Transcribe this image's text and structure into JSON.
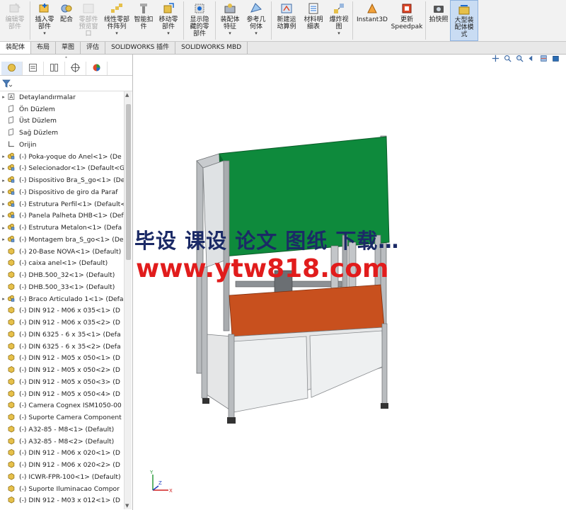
{
  "ribbon": {
    "buttons": [
      {
        "label": "编辑零\n部件",
        "disabled": true,
        "icon": "edit-component-icon",
        "dropdown": false
      },
      {
        "label": "插入零\n部件",
        "disabled": false,
        "icon": "insert-component-icon",
        "dropdown": true
      },
      {
        "label": "配合",
        "disabled": false,
        "icon": "mate-icon",
        "dropdown": false
      },
      {
        "label": "零部件\n预览窗\n口",
        "disabled": true,
        "icon": "component-preview-icon",
        "dropdown": false
      },
      {
        "label": "线性零部\n件阵列",
        "disabled": false,
        "icon": "linear-pattern-icon",
        "dropdown": true
      },
      {
        "label": "智能扣\n件",
        "disabled": false,
        "icon": "smart-fastener-icon",
        "dropdown": false
      },
      {
        "label": "移动零\n部件",
        "disabled": false,
        "icon": "move-component-icon",
        "dropdown": true
      },
      {
        "label": "显示隐\n藏的零\n部件",
        "disabled": false,
        "icon": "show-hidden-icon",
        "dropdown": false
      },
      {
        "label": "装配体\n特征",
        "disabled": false,
        "icon": "assembly-feature-icon",
        "dropdown": true
      },
      {
        "label": "参考几\n何体",
        "disabled": false,
        "icon": "reference-geometry-icon",
        "dropdown": true
      },
      {
        "label": "新建运\n动算例",
        "disabled": false,
        "icon": "motion-study-icon",
        "dropdown": false
      },
      {
        "label": "材料明\n细表",
        "disabled": false,
        "icon": "bom-icon",
        "dropdown": false
      },
      {
        "label": "爆炸视\n图",
        "disabled": false,
        "icon": "exploded-view-icon",
        "dropdown": true
      },
      {
        "label": "Instant3D",
        "disabled": false,
        "icon": "instant3d-icon",
        "dropdown": false
      },
      {
        "label": "更新\nSpeedpak",
        "disabled": false,
        "icon": "speedpak-icon",
        "dropdown": false
      },
      {
        "label": "拍快照",
        "disabled": false,
        "icon": "snapshot-icon",
        "dropdown": false
      },
      {
        "label": "大型装\n配体模\n式",
        "disabled": false,
        "icon": "large-assembly-icon",
        "dropdown": false,
        "active": true
      }
    ]
  },
  "tabs": [
    "装配体",
    "布局",
    "草图",
    "评估",
    "SOLIDWORKS 插件",
    "SOLIDWORKS MBD"
  ],
  "active_tab": "装配体",
  "tree": {
    "items": [
      {
        "label": "Detaylandırmalar",
        "icon": "annotations-icon",
        "expandable": true
      },
      {
        "label": "Ön Düzlem",
        "icon": "plane-icon",
        "expandable": false
      },
      {
        "label": "Üst Düzlem",
        "icon": "plane-icon",
        "expandable": false
      },
      {
        "label": "Sağ Düzlem",
        "icon": "plane-icon",
        "expandable": false
      },
      {
        "label": "Orijin",
        "icon": "origin-icon",
        "expandable": false
      },
      {
        "label": "(-) Poka-yoque do Anel<1> (De",
        "icon": "subassembly-icon",
        "expandable": true
      },
      {
        "label": "(-) Selecionador<1> (Default<G",
        "icon": "subassembly-icon",
        "expandable": true
      },
      {
        "label": "(-) Dispositivo Bra_S_go<1> (De",
        "icon": "subassembly-icon",
        "expandable": true
      },
      {
        "label": "(-) Dispositivo de giro da Paraf",
        "icon": "subassembly-icon",
        "expandable": true
      },
      {
        "label": "(-) Estrutura Perfil<1> (Default<",
        "icon": "subassembly-icon",
        "expandable": true
      },
      {
        "label": "(-) Panela Palheta DHB<1> (Def",
        "icon": "subassembly-icon",
        "expandable": true
      },
      {
        "label": "(-) Estrutura Metalon<1> (Defa",
        "icon": "subassembly-icon",
        "expandable": true
      },
      {
        "label": "(-) Montagem bra_S_go<1> (De",
        "icon": "subassembly-icon",
        "expandable": true
      },
      {
        "label": "(-) 20-Base NOVA<1> (Default)",
        "icon": "part-icon",
        "expandable": false
      },
      {
        "label": "(-) caixa anel<1> (Default)",
        "icon": "part-icon",
        "expandable": false
      },
      {
        "label": "(-) DHB.500_32<1> (Default)",
        "icon": "part-icon",
        "expandable": false
      },
      {
        "label": "(-) DHB.500_33<1> (Default)",
        "icon": "part-icon",
        "expandable": false
      },
      {
        "label": "(-) Braco Articulado 1<1> (Defa",
        "icon": "subassembly-icon",
        "expandable": true
      },
      {
        "label": "(-) DIN 912 - M06 x 035<1> (D",
        "icon": "part-icon",
        "expandable": false
      },
      {
        "label": "(-) DIN 912 - M06 x 035<2> (D",
        "icon": "part-icon",
        "expandable": false
      },
      {
        "label": "(-) DIN 6325 - 6 x 35<1> (Defa",
        "icon": "part-icon",
        "expandable": false
      },
      {
        "label": "(-) DIN 6325 - 6 x 35<2> (Defa",
        "icon": "part-icon",
        "expandable": false
      },
      {
        "label": "(-) DIN 912 - M05 x 050<1> (D",
        "icon": "part-icon",
        "expandable": false
      },
      {
        "label": "(-) DIN 912 - M05 x 050<2> (D",
        "icon": "part-icon",
        "expandable": false
      },
      {
        "label": "(-) DIN 912 - M05 x 050<3> (D",
        "icon": "part-icon",
        "expandable": false
      },
      {
        "label": "(-) DIN 912 - M05 x 050<4> (D",
        "icon": "part-icon",
        "expandable": false
      },
      {
        "label": "(-) Camera Cognex ISM1050-00",
        "icon": "part-icon",
        "expandable": false
      },
      {
        "label": "(-) Suporte Camera Component",
        "icon": "part-icon",
        "expandable": false
      },
      {
        "label": "(-) A32-85 - M8<1> (Default)",
        "icon": "part-icon",
        "expandable": false
      },
      {
        "label": "(-) A32-85 - M8<2> (Default)",
        "icon": "part-icon",
        "expandable": false
      },
      {
        "label": "(-) DIN 912 - M06 x 020<1> (D",
        "icon": "part-icon",
        "expandable": false
      },
      {
        "label": "(-) DIN 912 - M06 x 020<2> (D",
        "icon": "part-icon",
        "expandable": false
      },
      {
        "label": "(-) ICWR-FPR-100<1> (Default)",
        "icon": "part-icon",
        "expandable": false
      },
      {
        "label": "(-) Suporte Iluminacao Compor",
        "icon": "part-icon",
        "expandable": false
      },
      {
        "label": "(-) DIN 912 - M03 x 012<1> (D",
        "icon": "part-icon",
        "expandable": false
      }
    ]
  },
  "panel_tabs": [
    "featuremanager-icon",
    "propertymanager-icon",
    "configmanager-icon",
    "dimxpert-icon",
    "displaymanager-icon"
  ],
  "filter_icon": "filter-icon",
  "viewport": {
    "watermark_cn": "毕设 课设 论文 图纸 下载…",
    "watermark_url": "www.ytw818.com",
    "view_toolbar": [
      "view-orientation-icon",
      "zoom-to-fit-icon",
      "zoom-area-icon",
      "previous-view-icon",
      "section-view-icon",
      "display-style-icon"
    ],
    "triad_labels": {
      "x": "X",
      "y": "Y",
      "z": "Z"
    }
  },
  "colors": {
    "panel_green": "#0e8a3c",
    "frame_grey": "#b9bcbf",
    "table_orange": "#c8501e",
    "watermark_red": "#e11c1c",
    "watermark_navy": "#1b2a66"
  }
}
